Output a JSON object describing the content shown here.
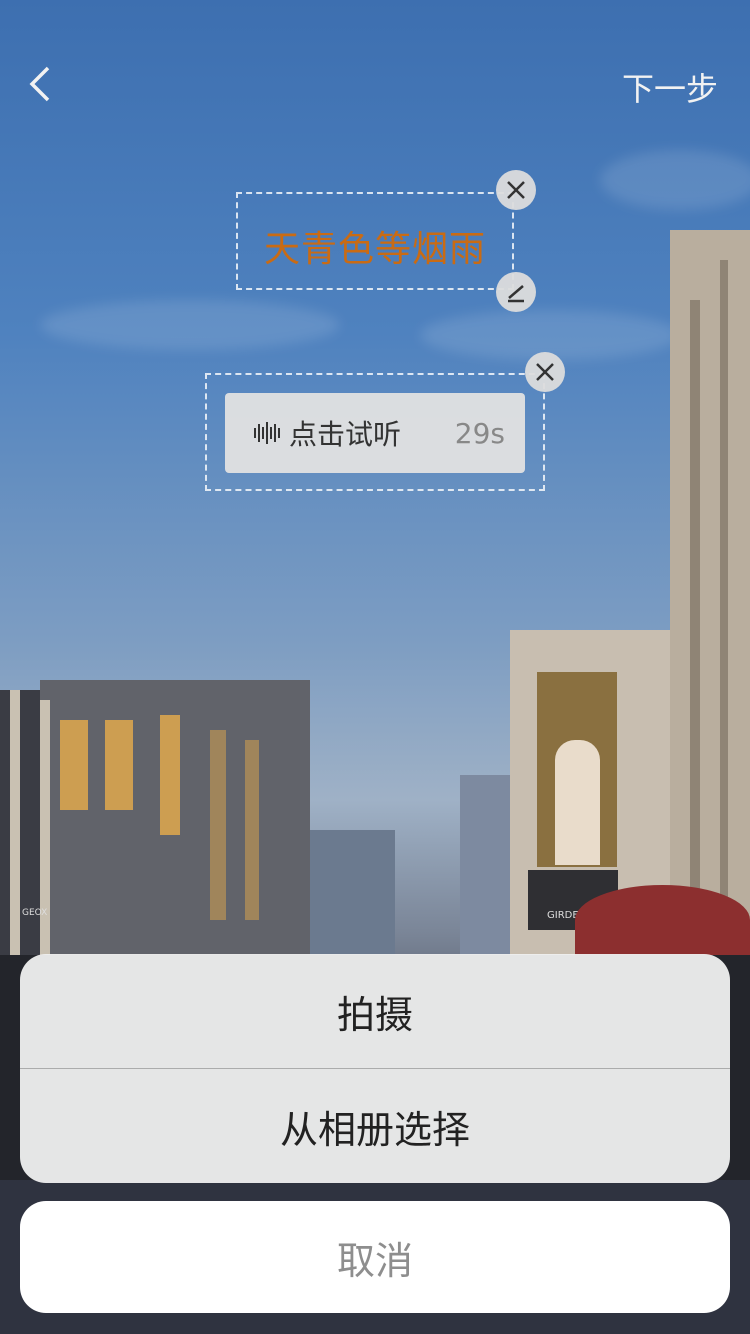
{
  "nav": {
    "next_label": "下一步"
  },
  "text_sticker": {
    "text": "天青色等烟雨",
    "color": "#c96b14"
  },
  "voice_sticker": {
    "label": "点击试听",
    "duration": "29s"
  },
  "action_sheet": {
    "options": [
      "拍摄",
      "从相册选择"
    ],
    "cancel_label": "取消"
  },
  "scene": {
    "signs": [
      "GIRDEAR",
      "GEOX"
    ]
  }
}
